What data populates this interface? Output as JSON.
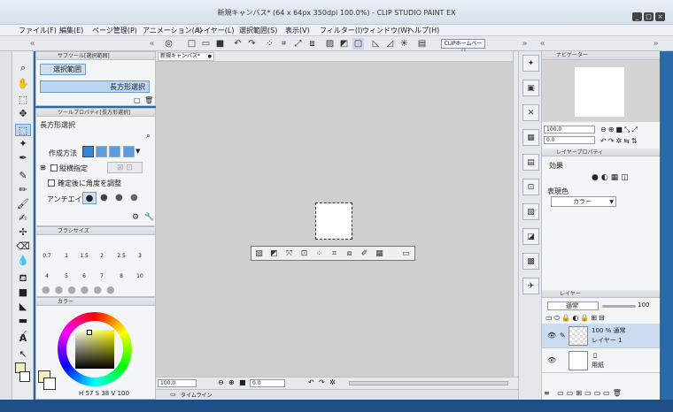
{
  "window": {
    "title": "新規キャンバス* (64 x 64px 350dpi 100.0%)  - CLIP STUDIO PAINT EX",
    "min": "_",
    "max": "□",
    "close": "×"
  },
  "menu": [
    "ファイル(F)",
    "編集(E)",
    "ページ管理(P)",
    "アニメーション(A)",
    "レイヤー(L)",
    "選択範囲(S)",
    "表示(V)",
    "フィルター(I)",
    "ウィンドウ(W)",
    "ヘルプ(H)"
  ],
  "command": {
    "clip_home": "CLIPホームページ"
  },
  "subtool": {
    "header": "サブツール[選択範囲]",
    "group_label": "選択範囲",
    "item_label": "長方形選択"
  },
  "toolprop": {
    "header": "ツールプロパティ[長方形選択]",
    "name": "長方形選択",
    "create_method": "作成方法",
    "aspect": "縦横指定",
    "rotate_after": "確定後に角度を調整",
    "antialias": "アンチエイリ"
  },
  "brush": {
    "header": "ブラシサイズ",
    "sizes": [
      "0.7",
      "1",
      "1.5",
      "2",
      "2.5",
      "3",
      "4",
      "5",
      "6",
      "7",
      "8",
      "10"
    ]
  },
  "color": {
    "header": "カラー",
    "h": "57",
    "s": "38",
    "v": "100",
    "h_label": "H",
    "s_label": "S",
    "v_label": "V"
  },
  "canvas": {
    "tab": "新規キャンバス*",
    "tab_close": "●"
  },
  "status": {
    "zoom": "100.0",
    "angle": "0.0"
  },
  "timeline": {
    "label": "タイムライン"
  },
  "navigator": {
    "header": "ナビゲーター",
    "zoom": "100.0",
    "angle": "0.0"
  },
  "layerprop": {
    "header": "レイヤープロパティ",
    "effect": "効果",
    "display_color": "表現色",
    "color_mode": "カラー"
  },
  "layers": {
    "header": "レイヤー",
    "blend": "通常",
    "opacity": "100",
    "items": [
      {
        "info": "100 % 通常",
        "name": "レイヤー 1"
      },
      {
        "info": "",
        "name": "用紙"
      }
    ]
  },
  "colors": {
    "accent": "#6f9ccb",
    "panel": "#f3f5f7",
    "canvas_bg": "#cfcfcf",
    "main": "#f2f0c2",
    "sub": "#ffffff"
  }
}
